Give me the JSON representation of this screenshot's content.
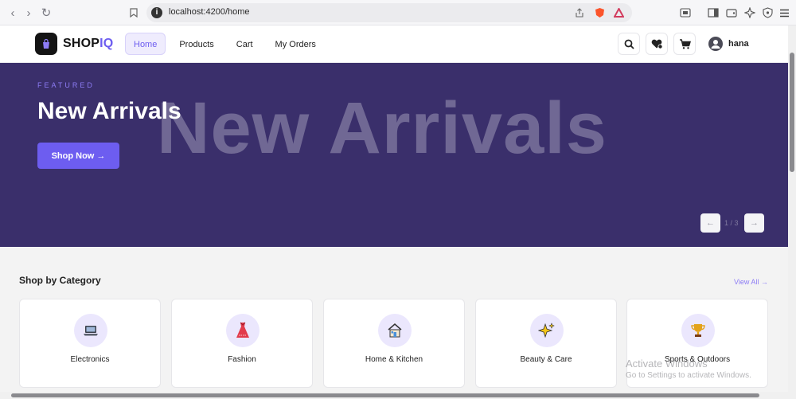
{
  "browser": {
    "url": "localhost:4200/home"
  },
  "header": {
    "brand_main": "SHOP",
    "brand_accent": "IQ",
    "nav": [
      {
        "label": "Home",
        "active": true
      },
      {
        "label": "Products",
        "active": false
      },
      {
        "label": "Cart",
        "active": false
      },
      {
        "label": "My Orders",
        "active": false
      }
    ],
    "username": "hana"
  },
  "hero": {
    "eyebrow": "FEATURED",
    "title": "New Arrivals",
    "watermark": "New Arrivals",
    "cta": "Shop Now →",
    "prev": "←",
    "next": "→",
    "counter": "1 / 3"
  },
  "categories": {
    "title": "Shop by Category",
    "view_all": "View All →",
    "items": [
      {
        "label": "Electronics",
        "icon": "laptop-icon",
        "glyph": "💻"
      },
      {
        "label": "Fashion",
        "icon": "dress-icon",
        "glyph": "👗"
      },
      {
        "label": "Home & Kitchen",
        "icon": "house-icon",
        "glyph": "🏠"
      },
      {
        "label": "Beauty & Care",
        "icon": "sparkles-icon",
        "glyph": "✨"
      },
      {
        "label": "Sports & Outdoors",
        "icon": "trophy-icon",
        "glyph": "🏆"
      }
    ]
  },
  "os_watermark": {
    "line1": "Activate Windows",
    "line2": "Go to Settings to activate Windows."
  },
  "colors": {
    "accent": "#6d5df0",
    "hero_bg": "#3a2f6b",
    "page_bg": "#f3f3f3"
  }
}
